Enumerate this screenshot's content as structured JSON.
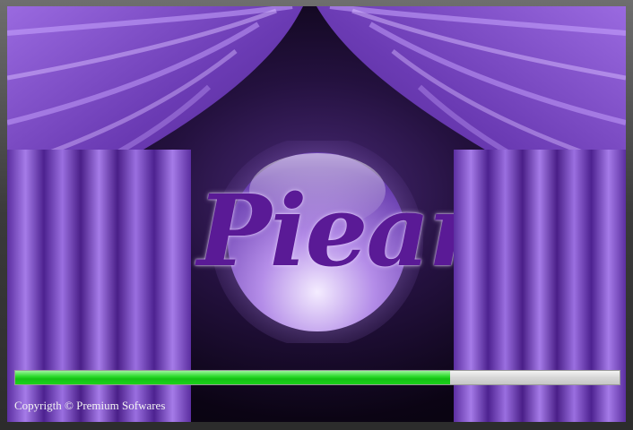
{
  "splash": {
    "logo_text": "Piear",
    "progress": 0.72,
    "copyright": "Copyrigth © Premium Sofwares"
  },
  "colors": {
    "curtain": "#7a4bc4",
    "progress_fill": "#22cc22",
    "logo_text": "#5a1a96"
  }
}
